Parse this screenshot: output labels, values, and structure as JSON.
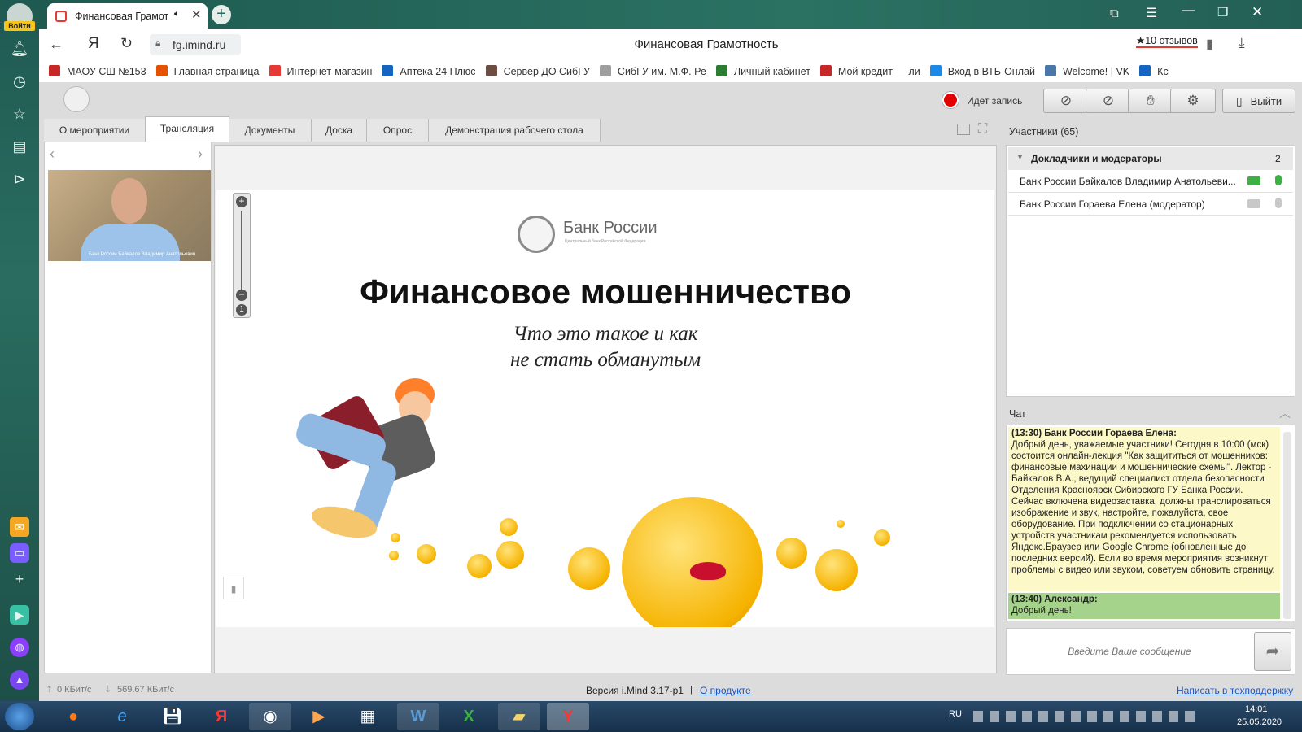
{
  "browser": {
    "tab_title": "Финансовая Грамот",
    "login_label": "Войти",
    "url": "fg.imind.ru",
    "page_title": "Финансовая Грамотность",
    "reviews": "★10 отзывов",
    "bookmarks": [
      {
        "label": "МАОУ СШ №153",
        "color": "#c62828"
      },
      {
        "label": "Главная страница",
        "color": "#e65100"
      },
      {
        "label": "Интернет-магазин",
        "color": "#e53935"
      },
      {
        "label": "Аптека 24 Плюс",
        "color": "#1565c0"
      },
      {
        "label": "Сервер ДО СибГУ",
        "color": "#6d4c41"
      },
      {
        "label": "СибГУ им. М.Ф. Ре",
        "color": "#9e9e9e"
      },
      {
        "label": "Личный кабинет",
        "color": "#2e7d32"
      },
      {
        "label": "Мой кредит — ли",
        "color": "#c62828"
      },
      {
        "label": "Вход в ВТБ-Онлай",
        "color": "#1e88e5"
      },
      {
        "label": "Welcome! | VK",
        "color": "#4a76a8"
      },
      {
        "label": "Кс",
        "color": "#1565c0"
      }
    ]
  },
  "app": {
    "recording_label": "Идет запись",
    "exit_label": "Выйти",
    "tabs": [
      "О мероприятии",
      "Трансляция",
      "Документы",
      "Доска",
      "Опрос",
      "Демонстрация рабочего стола"
    ],
    "active_tab": "Трансляция",
    "video_caption": "Банк России Байкалов Владимир Анатольевич",
    "slide": {
      "bank_name": "Банк России",
      "bank_subtitle": "Центральный банк Российской Федерации",
      "title": "Финансовое мошенничество",
      "subtitle_line1": "Что это такое и как",
      "subtitle_line2": "не стать обманутым"
    },
    "participants": {
      "header": "Участники (65)",
      "group_label": "Докладчики и модераторы",
      "group_count": "2",
      "list": [
        {
          "name": "Банк России Байкалов Владимир Анатольеви...",
          "cam_color": "#3cb043",
          "mic_color": "#3cb043"
        },
        {
          "name": "Банк России Гораева Елена (модератор)",
          "cam_color": "#c8c8c8",
          "mic_color": "#c8c8c8"
        }
      ]
    },
    "chat": {
      "header": "Чат",
      "messages": [
        {
          "author": "(13:30) Банк России Гораева Елена:",
          "text": "Добрый день, уважаемые участники! Сегодня в 10:00 (мск) состоится онлайн-лекция \"Как защититься от мошенников: финансовые махинации и мошеннические схемы\". Лектор - Байкалов В.А., ведущий специалист отдела безопасности Отделения Красноярск Сибирского ГУ Банка России. Сейчас включена видеозаставка, должны транслироваться изображение и звук, настройте, пожалуйста, свое оборудование. При подключении со стационарных устройств участникам рекомендуется использовать Яндекс.Браузер или Google Chrome (обновленные до последних версий). Если во время мероприятия возникнут проблемы с видео или звуком, советуем обновить страницу.",
          "bg": "#fdf8c8"
        },
        {
          "author": "(13:40) Александр:",
          "text": "Добрый день!",
          "bg": "#a6d38b"
        }
      ],
      "input_placeholder": "Введите Ваше сообщение"
    },
    "status": {
      "upload": "0 КБит/с",
      "download": "569.67 КБит/с",
      "version": "Версия i.Mind 3.17-p1",
      "about_link": "О продукте",
      "support_link": "Написать в техподдержку"
    }
  },
  "taskbar": {
    "lang": "RU",
    "time": "14:01",
    "date": "25.05.2020"
  }
}
